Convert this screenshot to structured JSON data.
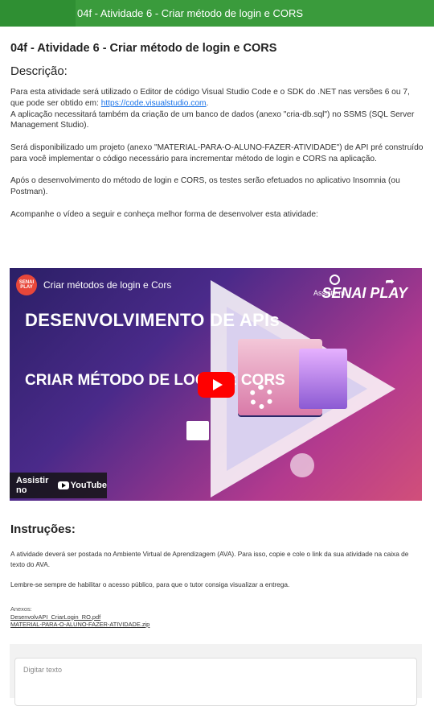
{
  "topbar": {
    "title": "04f - Atividade 6 - Criar método de login e CORS"
  },
  "page": {
    "title": "04f - Atividade 6 - Criar método de login e CORS",
    "description_heading": "Descrição:",
    "p1_text": "Para esta atividade será utilizado o Editor de código Visual Studio Code e o SDK do .NET nas versões 6 ou 7, que pode ser obtido em: ",
    "p1_link": "https://code.visualstudio.com",
    "p1_end": ".",
    "p2": "A aplicação necessitará também da criação de um banco de dados (anexo \"cria-db.sql\") no SSMS (SQL Server Management Studio).",
    "p3": "Será disponibilizado um projeto (anexo \"MATERIAL-PARA-O-ALUNO-FAZER-ATIVIDADE\") de API pré construído para você implementar o código necessário para incrementar método de login e CORS na aplicação.",
    "p4": "Após o desenvolvimento do método de login e CORS, os testes serão efetuados no aplicativo Insomnia (ou Postman).",
    "p5": "Acompanhe o vídeo a seguir e conheça melhor forma de desenvolver esta atividade:"
  },
  "video": {
    "channel_avatar": "SENAI PLAY",
    "title": "Criar métodos de login e Cors",
    "watch_later": "Assistir m...",
    "share": "Compartilh...",
    "headline1": "DESENVOLVIMENTO DE APIs",
    "headline2": "CRIAR MÉTODO DE LOGIN E CORS",
    "brand": "SENAI PLAY",
    "watch_on": "Assistir no",
    "youtube": "YouTube"
  },
  "instructions": {
    "heading": "Instruções:",
    "p1": "A atividade deverá ser postada no Ambiente Virtual de Aprendizagem (AVA). Para isso, copie e cole o link da sua atividade na caixa de texto do AVA.",
    "p2": "Lembre-se sempre de habilitar o acesso público, para que o tutor consiga visualizar a entrega."
  },
  "attachments": {
    "label": "Anexos:",
    "files": [
      "DesenvolvAPI_CriarLogin_RO.pdf",
      "MATERIAL-PARA-O-ALUNO-FAZER-ATIVIDADE.zip"
    ]
  },
  "editor": {
    "placeholder": "Digitar texto"
  }
}
